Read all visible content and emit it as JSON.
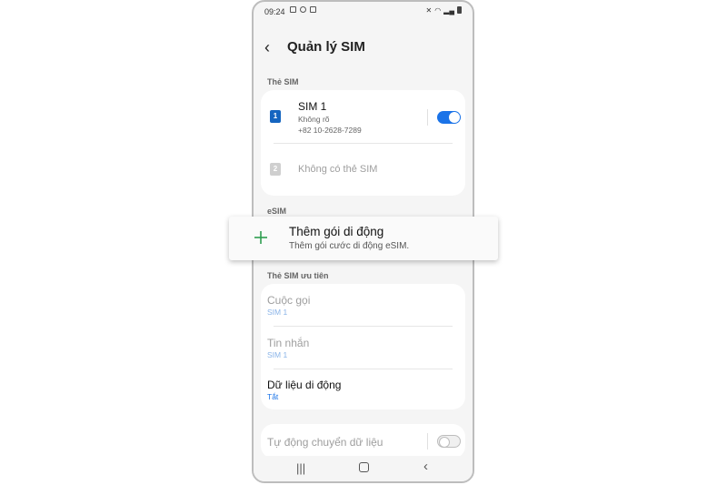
{
  "status_bar": {
    "time": "09:24"
  },
  "header": {
    "title": "Quản lý SIM"
  },
  "sim_cards": {
    "section_label": "Thẻ SIM",
    "sim1": {
      "badge": "1",
      "name": "SIM 1",
      "status": "Không rõ",
      "number": "+82 10-2628-7289",
      "enabled": true
    },
    "sim2": {
      "badge": "2",
      "label": "Không có thẻ SIM"
    }
  },
  "esim": {
    "section_label": "eSIM",
    "add_plan": {
      "title": "Thêm gói di động",
      "subtitle": "Thêm gói cước di động eSIM."
    }
  },
  "preferred_sim": {
    "section_label": "Thẻ SIM ưu tiên",
    "items": [
      {
        "title": "Cuộc gọi",
        "value": "SIM 1"
      },
      {
        "title": "Tin nhắn",
        "value": "SIM 1"
      },
      {
        "title": "Dữ liệu di động",
        "value": "Tắt"
      }
    ]
  },
  "auto_switch": {
    "label": "Tự động chuyển dữ liệu",
    "enabled": false
  },
  "colors": {
    "accent": "#1a73e8",
    "plus": "#2e9e4f",
    "sim_badge": "#1565c0"
  }
}
